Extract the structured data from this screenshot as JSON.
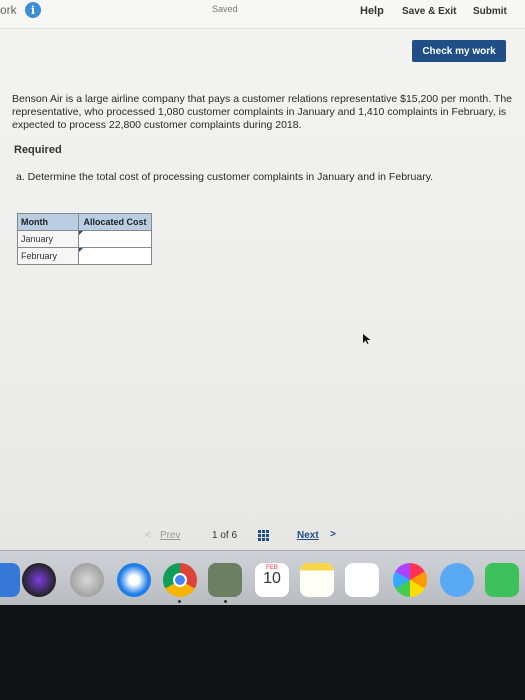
{
  "topbar": {
    "brand": "ork",
    "info_icon": "i",
    "saved": "Saved",
    "help": "Help",
    "save_exit": "Save & Exit",
    "submit": "Submit"
  },
  "check_button": "Check my work",
  "question": {
    "text": "Benson Air is a large airline company that pays a customer relations representative $15,200 per month. The representative, who processed 1,080 customer complaints in January and 1,410 complaints in February, is expected to process 22,800 customer complaints during 2018.",
    "required": "Required",
    "part_a": "a. Determine the total cost of processing customer complaints in January and in February."
  },
  "table": {
    "headers": [
      "Month",
      "Allocated Cost"
    ],
    "rows": [
      {
        "month": "January",
        "cost": ""
      },
      {
        "month": "February",
        "cost": ""
      }
    ]
  },
  "pager": {
    "prev_chevron": "<",
    "prev": "Prev",
    "page": "1 of 6",
    "next": "Next",
    "next_chevron": ">"
  },
  "dock": {
    "calendar_month": "FEB",
    "calendar_day": "10",
    "icons": [
      "finder-icon",
      "siri-icon",
      "launchpad-icon",
      "safari-icon",
      "chrome-icon",
      "photo-app-icon",
      "calendar-icon",
      "notes-icon",
      "reminders-icon",
      "photos-icon",
      "messages-icon",
      "facetime-icon"
    ]
  }
}
